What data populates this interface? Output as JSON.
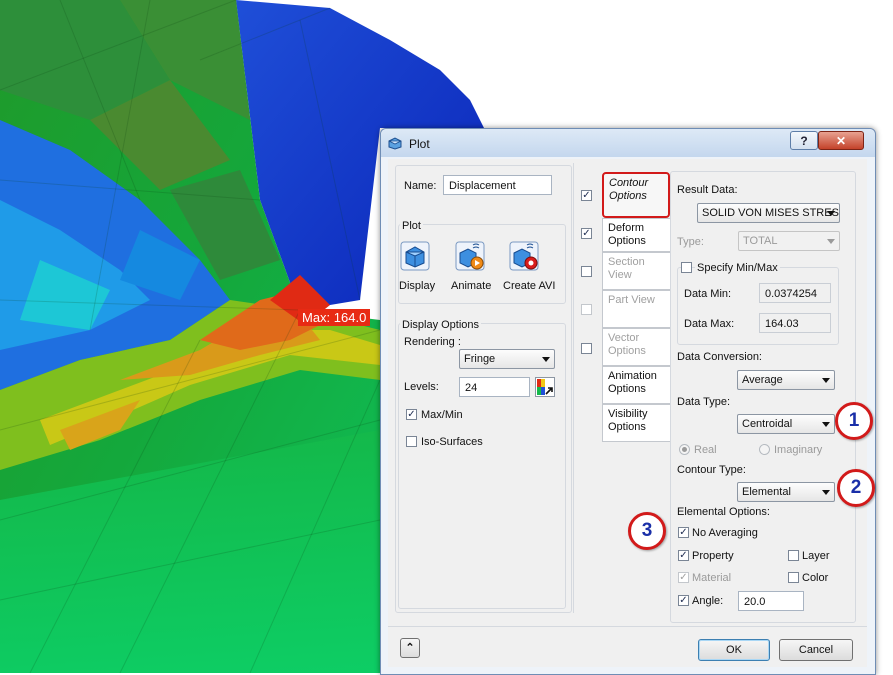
{
  "viewport": {
    "max_label": "Max: 164.0"
  },
  "callouts": [
    "1",
    "2",
    "3"
  ],
  "dialog": {
    "title": "Plot",
    "help_button": "?",
    "close_button": "✕",
    "name_label": "Name:",
    "name_value": "Displacement",
    "plot_group": {
      "title": "Plot",
      "buttons": [
        {
          "label": "Display",
          "icon": "display-icon"
        },
        {
          "label": "Animate",
          "icon": "animate-icon"
        },
        {
          "label": "Create AVI",
          "icon": "create-avi-icon"
        }
      ]
    },
    "display_options": {
      "title": "Display Options",
      "rendering_label": "Rendering :",
      "rendering_value": "Fringe",
      "levels_label": "Levels:",
      "levels_value": "24",
      "maxmin_label": "Max/Min",
      "maxmin_checked": true,
      "iso_label": "Iso-Surfaces",
      "iso_checked": false
    },
    "tabs": [
      {
        "label": "Contour Options",
        "checked": true
      },
      {
        "label": "Deform Options",
        "checked": true
      },
      {
        "label": "Section View",
        "checked": false
      },
      {
        "label": "Part View",
        "checked": false
      },
      {
        "label": "Vector Options",
        "checked": false
      },
      {
        "label": "Animation Options"
      },
      {
        "label": "Visibility Options"
      }
    ],
    "contour": {
      "result_data_label": "Result Data:",
      "result_data_value": "SOLID VON MISES STRES",
      "type_label": "Type:",
      "type_value": "TOTAL",
      "specify_minmax_label": "Specify Min/Max",
      "data_min_label": "Data Min:",
      "data_min_value": "0.0374254",
      "data_max_label": "Data Max:",
      "data_max_value": "164.03",
      "data_conversion_label": "Data Conversion:",
      "data_conversion_value": "Average",
      "data_type_label": "Data Type:",
      "data_type_value": "Centroidal",
      "real_label": "Real",
      "imaginary_label": "Imaginary",
      "contour_type_label": "Contour Type:",
      "contour_type_value": "Elemental",
      "elemental_options_label": "Elemental Options:",
      "no_averaging_label": "No Averaging",
      "property_label": "Property",
      "layer_label": "Layer",
      "material_label": "Material",
      "color_label": "Color",
      "angle_label": "Angle:",
      "angle_value": "20.0"
    },
    "collapse_button": "⌃",
    "ok_label": "OK",
    "cancel_label": "Cancel"
  }
}
